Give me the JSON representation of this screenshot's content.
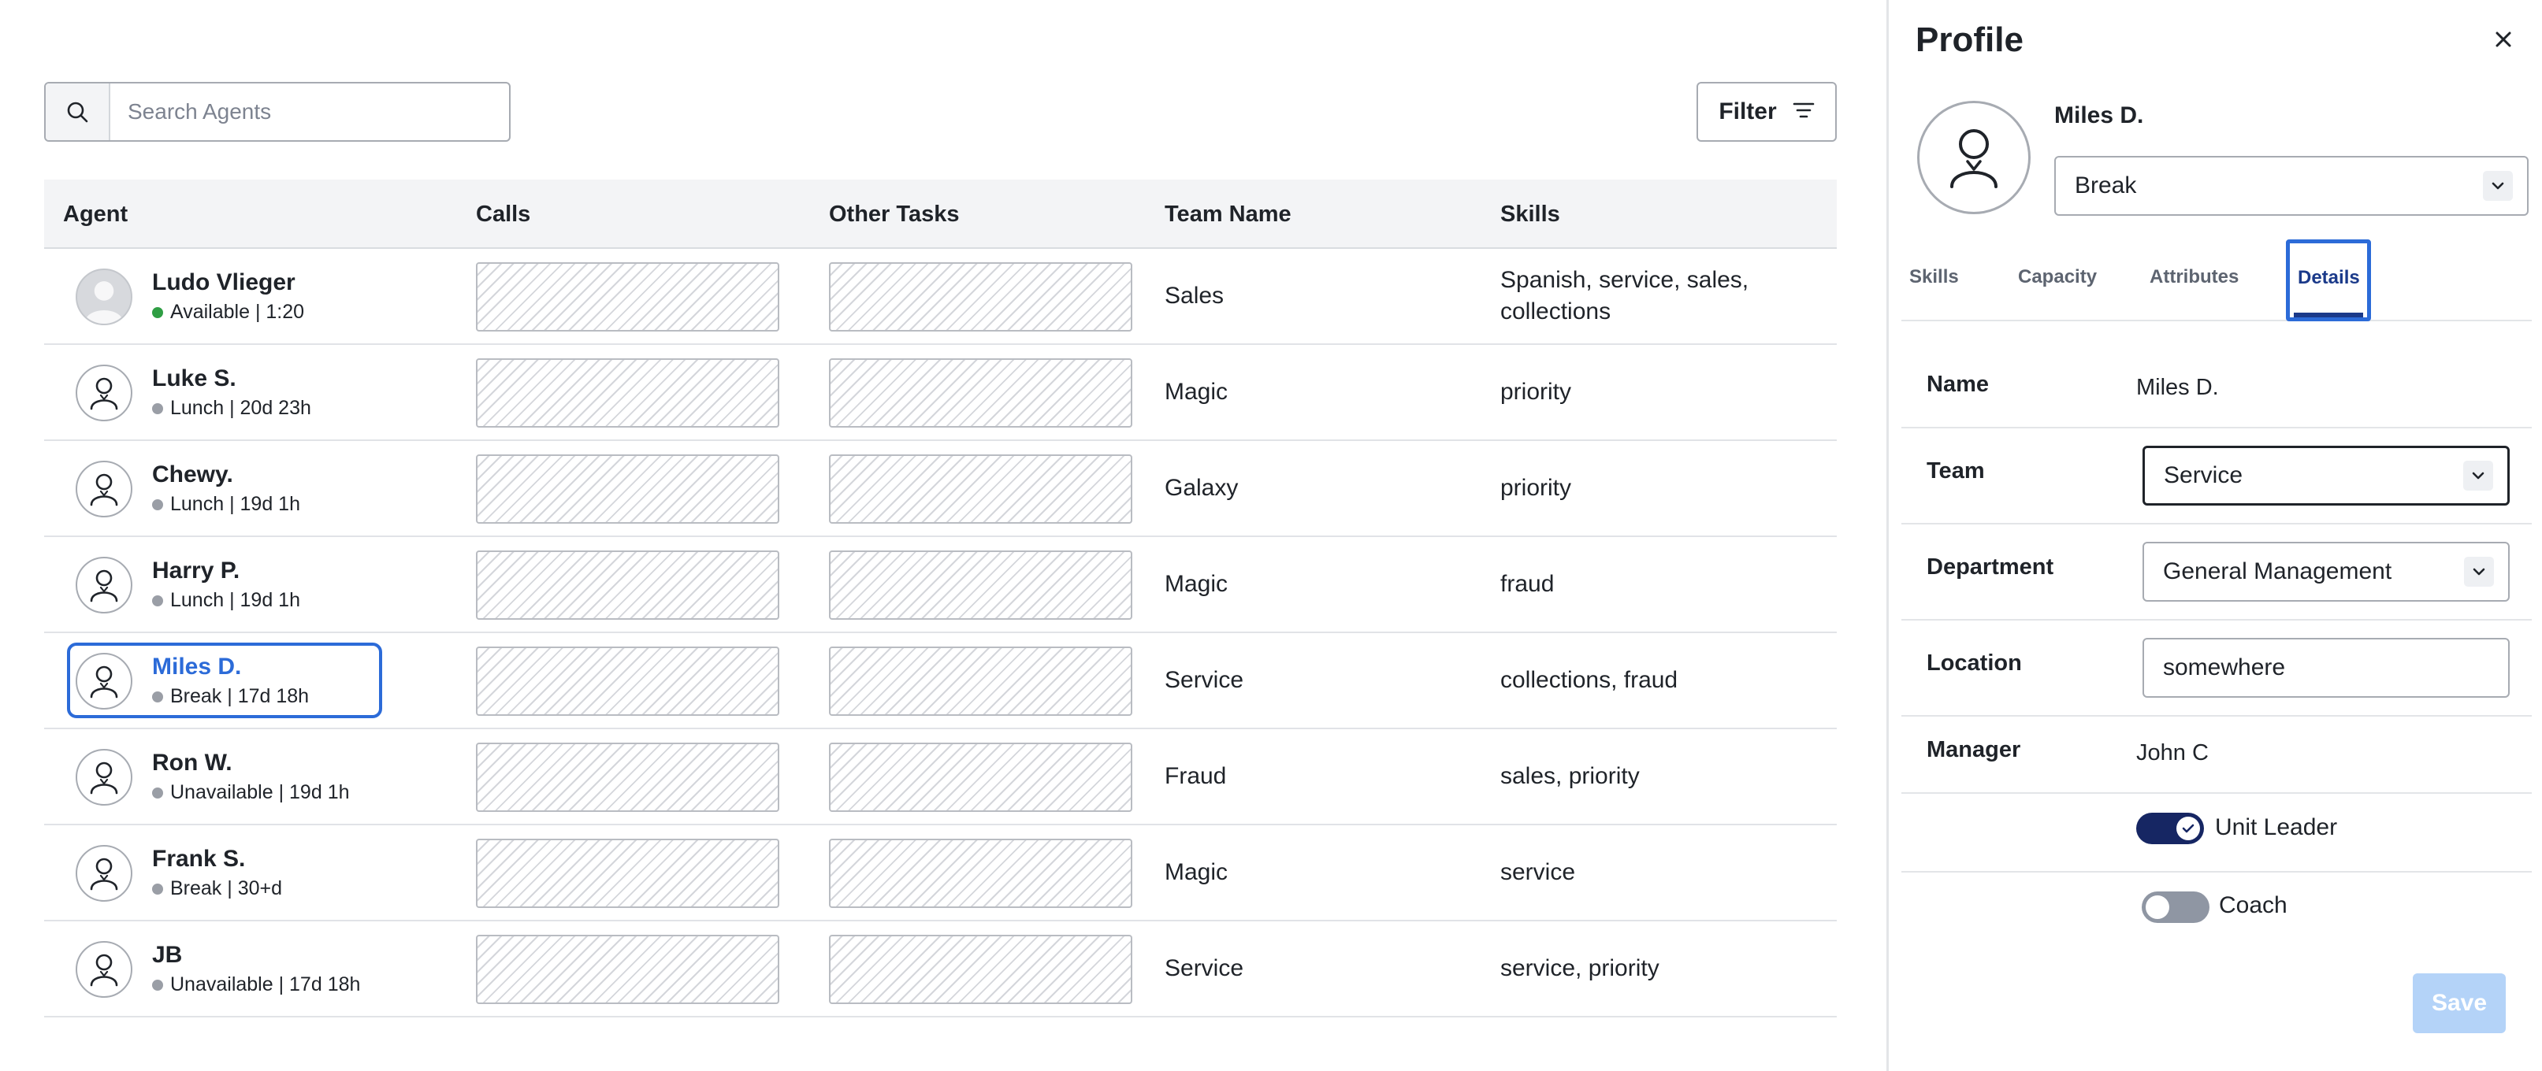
{
  "search": {
    "placeholder": "Search Agents",
    "icon": "search-icon"
  },
  "filter": {
    "label": "Filter",
    "icon": "filter-lines-icon"
  },
  "table": {
    "headers": [
      "Agent",
      "Calls",
      "Other Tasks",
      "Team Name",
      "Skills"
    ],
    "rows": [
      {
        "name": "Ludo Vlieger",
        "status": "Available",
        "time": "1:20",
        "status_color": "#2f9e44",
        "avatar": "photo-avatar",
        "team": "Sales",
        "skills": "Spanish, service, sales,",
        "skills_line2": "collections",
        "selected": false
      },
      {
        "name": "Luke S.",
        "status": "Lunch",
        "time": "20d 23h",
        "status_color": "#9a9ea6",
        "avatar": "user-icon",
        "team": "Magic",
        "skills": "priority",
        "skills_line2": "",
        "selected": false
      },
      {
        "name": "Chewy.",
        "status": "Lunch",
        "time": "19d 1h",
        "status_color": "#9a9ea6",
        "avatar": "user-icon",
        "team": "Galaxy",
        "skills": "priority",
        "skills_line2": "",
        "selected": false
      },
      {
        "name": "Harry P.",
        "status": "Lunch",
        "time": "19d 1h",
        "status_color": "#9a9ea6",
        "avatar": "user-icon",
        "team": "Magic",
        "skills": "fraud",
        "skills_line2": "",
        "selected": false
      },
      {
        "name": "Miles D.",
        "status": "Break",
        "time": "17d 18h",
        "status_color": "#9a9ea6",
        "avatar": "user-icon",
        "team": "Service",
        "skills": "collections, fraud",
        "skills_line2": "",
        "selected": true
      },
      {
        "name": "Ron W.",
        "status": "Unavailable",
        "time": "19d 1h",
        "status_color": "#9a9ea6",
        "avatar": "user-icon",
        "team": "Fraud",
        "skills": "sales, priority",
        "skills_line2": "",
        "selected": false
      },
      {
        "name": "Frank S.",
        "status": "Break",
        "time": "30+d",
        "status_color": "#9a9ea6",
        "avatar": "user-icon",
        "team": "Magic",
        "skills": "service",
        "skills_line2": "",
        "selected": false
      },
      {
        "name": "JB",
        "status": "Unavailable",
        "time": "17d 18h",
        "status_color": "#9a9ea6",
        "avatar": "user-icon",
        "team": "Service",
        "skills": "service, priority",
        "skills_line2": "",
        "selected": false
      }
    ]
  },
  "profile": {
    "title": "Profile",
    "close_icon": "close-icon",
    "name": "Miles D.",
    "status_value": "Break",
    "tabs": [
      "Skills",
      "Capacity",
      "Attributes",
      "Details"
    ],
    "active_tab": "Details",
    "details": {
      "name_label": "Name",
      "name_value": "Miles D.",
      "team_label": "Team",
      "team_value": "Service",
      "department_label": "Department",
      "department_value": "General Management",
      "location_label": "Location",
      "location_value": "somewhere",
      "manager_label": "Manager",
      "manager_value": "John C",
      "unit_leader_label": "Unit Leader",
      "unit_leader_on": true,
      "coach_label": "Coach",
      "coach_on": false
    },
    "save_label": "Save"
  },
  "colors": {
    "accent": "#2c6bd8",
    "navy": "#1b3a8a",
    "toggle_on": "#162663",
    "save_disabled": "#b4d3f8"
  }
}
